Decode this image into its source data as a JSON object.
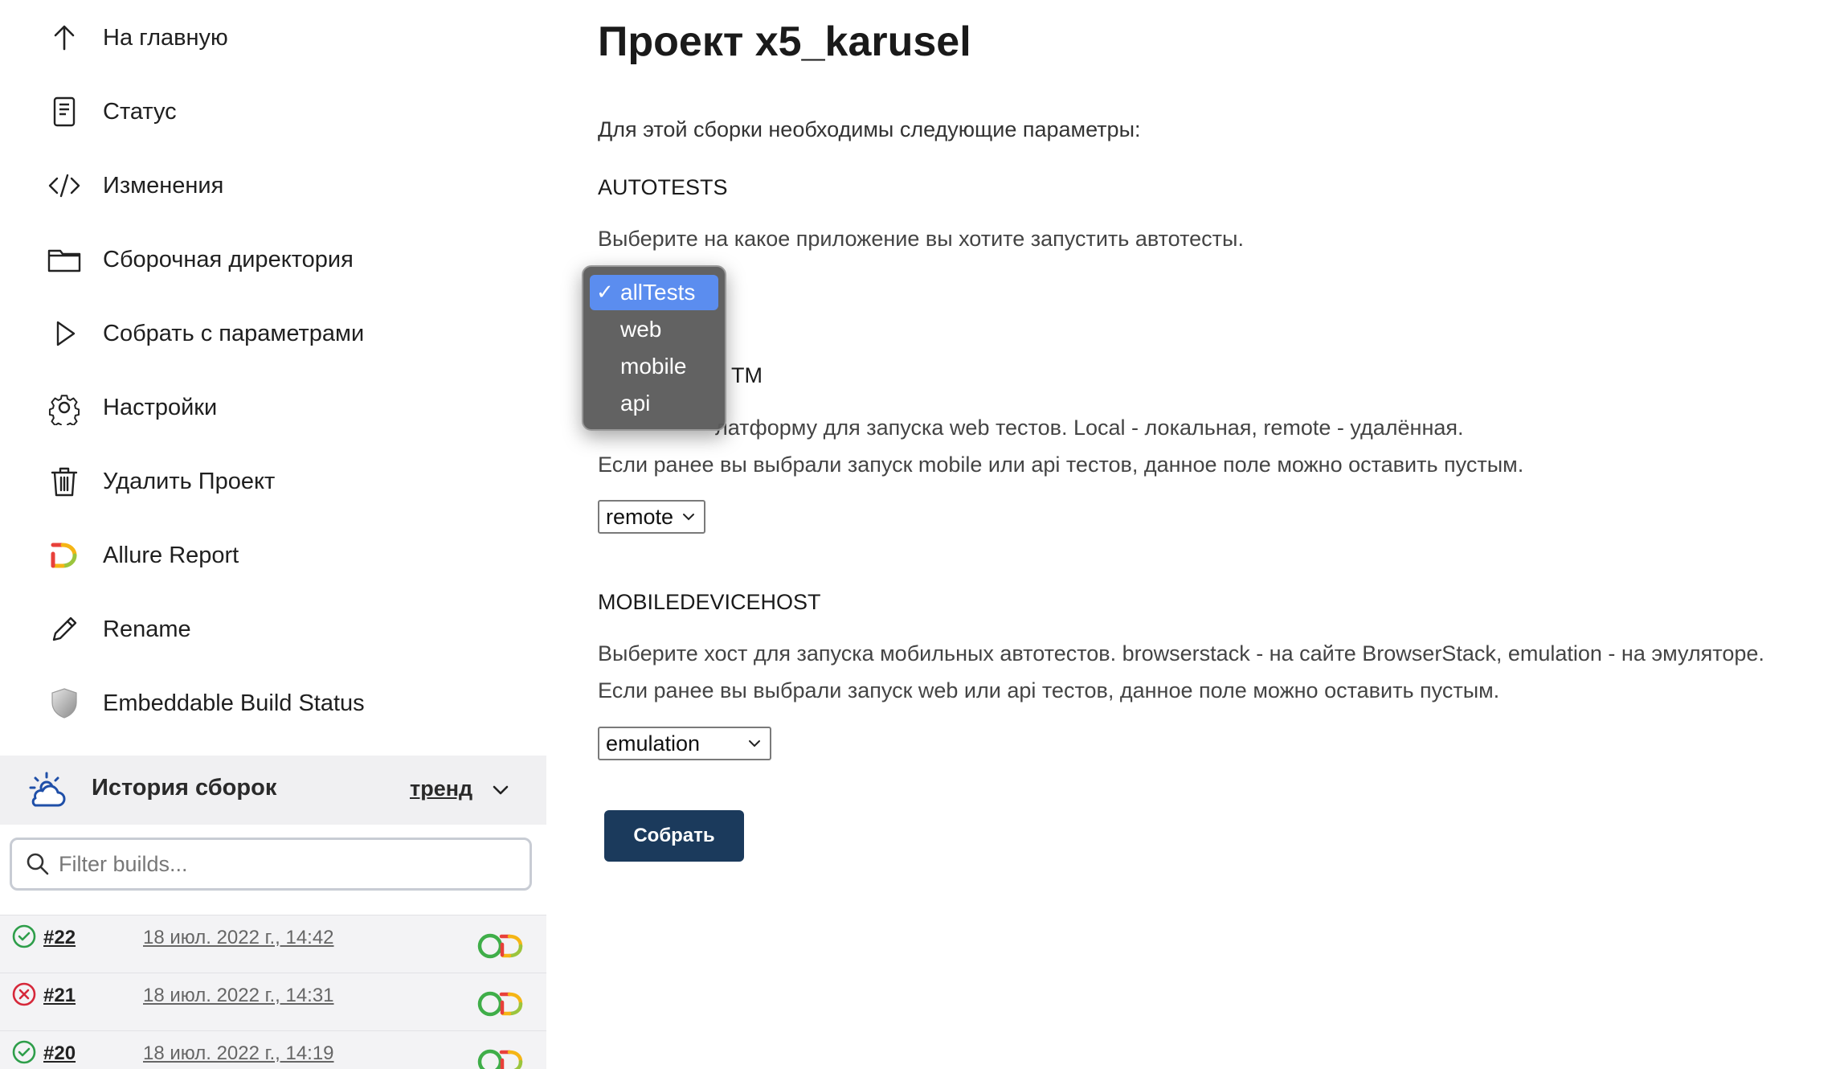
{
  "sidebar": {
    "nav": [
      {
        "label": "На главную",
        "icon": "arrow-up-icon"
      },
      {
        "label": "Статус",
        "icon": "document-icon"
      },
      {
        "label": "Изменения",
        "icon": "code-icon"
      },
      {
        "label": "Сборочная директория",
        "icon": "folder-icon"
      },
      {
        "label": "Собрать с параметрами",
        "icon": "play-icon"
      },
      {
        "label": "Настройки",
        "icon": "gear-icon"
      },
      {
        "label": "Удалить Проект",
        "icon": "trash-icon"
      },
      {
        "label": "Allure Report",
        "icon": "allure-icon"
      },
      {
        "label": "Rename",
        "icon": "pencil-icon"
      },
      {
        "label": "Embeddable Build Status",
        "icon": "shield-icon"
      }
    ],
    "history": {
      "title": "История сборок",
      "trend_label": "тренд",
      "filter_placeholder": "Filter builds...",
      "builds": [
        {
          "number": "#22",
          "date": "18 июл. 2022 г., 14:42",
          "status": "success"
        },
        {
          "number": "#21",
          "date": "18 июл. 2022 г., 14:31",
          "status": "failed"
        },
        {
          "number": "#20",
          "date": "18 июл. 2022 г., 14:19",
          "status": "success"
        }
      ]
    }
  },
  "main": {
    "title": "Проект x5_karusel",
    "intro": "Для этой сборки необходимы следующие параметры:",
    "params": {
      "autotests": {
        "name": "AUTOTESTS",
        "desc": "Выберите на какое приложение вы хотите запустить автотесты.",
        "selected": "allTests",
        "options": [
          "allTests",
          "web",
          "mobile",
          "api"
        ]
      },
      "platform": {
        "name_visible": "ТМ",
        "desc_line1_visible": "латформу для запуска web тестов. Local - локальная, remote - удалённая.",
        "desc_line2": "Если ранее вы выбрали запуск mobile или api тестов, данное поле можно оставить пустым.",
        "selected": "remote"
      },
      "mobiledevicehost": {
        "name": "MOBILEDEVICEHOST",
        "desc_line1": "Выберите хост для запуска мобильных автотестов. browserstack - на сайте BrowserStack, emulation - на эмуляторе.",
        "desc_line2": "Если ранее вы выбрали запуск web или api тестов, данное поле можно оставить пустым.",
        "selected": "emulation"
      }
    },
    "submit_label": "Собрать"
  },
  "colors": {
    "submit_bg": "#1b3a5c",
    "dropdown_highlight": "#5b8def",
    "success": "#2e9e4a",
    "failure": "#d6283a"
  }
}
